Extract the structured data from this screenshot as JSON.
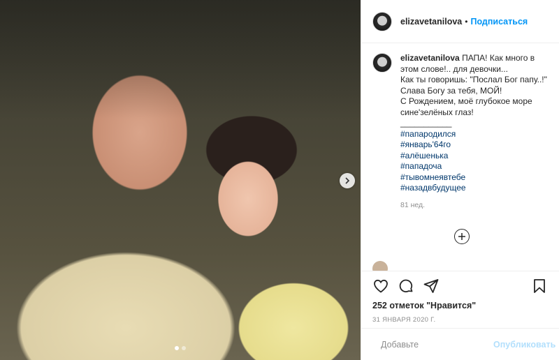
{
  "photo": {
    "alt": "",
    "slide_count": 2,
    "active_slide": 0
  },
  "header": {
    "username": "elizavetanilova",
    "separator": "•",
    "follow_label": "Подписаться"
  },
  "caption": {
    "username": "elizavetanilova",
    "lines": [
      "ПАПА! Как много в этом слове!.. для девочки...",
      "Как ты говоришь: \"Послал Бог папу..!\" Слава Богу за тебя, МОЙ!",
      "С Рождением, моё глубокое море сине'зелёных глаз!",
      "___________"
    ],
    "hashtags": [
      "#папародился",
      "#январь'64го",
      "#алёшенька",
      "#пападоча",
      "#тывомнеявтебе",
      "#назадвбудущее"
    ],
    "time_ago": "81 нед."
  },
  "actions": {
    "like_icon": "heart-icon",
    "comment_icon": "comment-icon",
    "share_icon": "share-icon",
    "save_icon": "bookmark-icon"
  },
  "likes": {
    "text": "252 отметок \"Нравится\""
  },
  "date": {
    "text": "31 ЯНВАРЯ 2020 Г."
  },
  "add_comment": {
    "placeholder": "Добавьте",
    "publish_label": "Опубликовать"
  },
  "colors": {
    "accent": "#0095f6",
    "hashtag": "#00376b",
    "muted": "#8e8e8e",
    "publish_disabled": "#b2dffc"
  }
}
